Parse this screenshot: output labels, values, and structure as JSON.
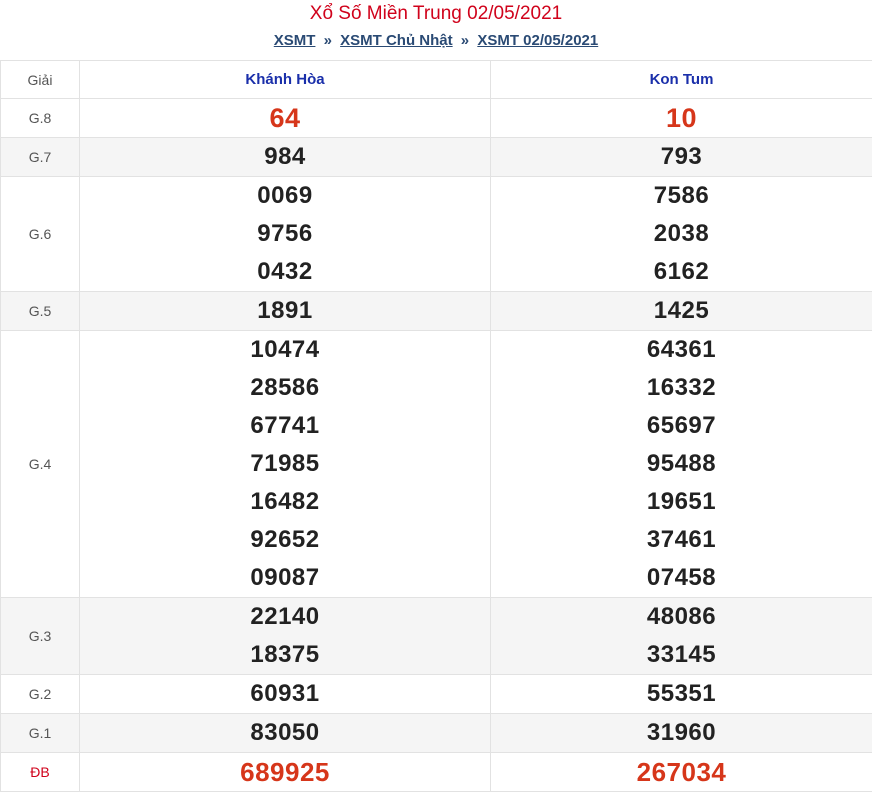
{
  "page": {
    "title": "Xổ Số Miền Trung 02/05/2021",
    "breadcrumb": [
      {
        "label": "XSMT"
      },
      {
        "label": "XSMT Chủ Nhật"
      },
      {
        "label": "XSMT 02/05/2021"
      }
    ],
    "separator": "»"
  },
  "table": {
    "header": {
      "giai": "Giải",
      "col1": "Khánh Hòa",
      "col2": "Kon Tum"
    },
    "rows": [
      {
        "label": "G.8",
        "col1": [
          "64"
        ],
        "col2": [
          "10"
        ]
      },
      {
        "label": "G.7",
        "col1": [
          "984"
        ],
        "col2": [
          "793"
        ]
      },
      {
        "label": "G.6",
        "col1": [
          "0069",
          "9756",
          "0432"
        ],
        "col2": [
          "7586",
          "2038",
          "6162"
        ]
      },
      {
        "label": "G.5",
        "col1": [
          "1891"
        ],
        "col2": [
          "1425"
        ]
      },
      {
        "label": "G.4",
        "col1": [
          "10474",
          "28586",
          "67741",
          "71985",
          "16482",
          "92652",
          "09087"
        ],
        "col2": [
          "64361",
          "16332",
          "65697",
          "95488",
          "19651",
          "37461",
          "07458"
        ]
      },
      {
        "label": "G.3",
        "col1": [
          "22140",
          "18375"
        ],
        "col2": [
          "48086",
          "33145"
        ]
      },
      {
        "label": "G.2",
        "col1": [
          "60931"
        ],
        "col2": [
          "55351"
        ]
      },
      {
        "label": "G.1",
        "col1": [
          "83050"
        ],
        "col2": [
          "31960"
        ]
      },
      {
        "label": "ĐB",
        "col1": [
          "689925"
        ],
        "col2": [
          "267034"
        ]
      }
    ]
  },
  "colors": {
    "title_red": "#d0021b",
    "prize_red": "#d6361a",
    "link_blue": "#2a4a74",
    "header_blue": "#1a2faa",
    "row_alt": "#f5f5f5"
  }
}
